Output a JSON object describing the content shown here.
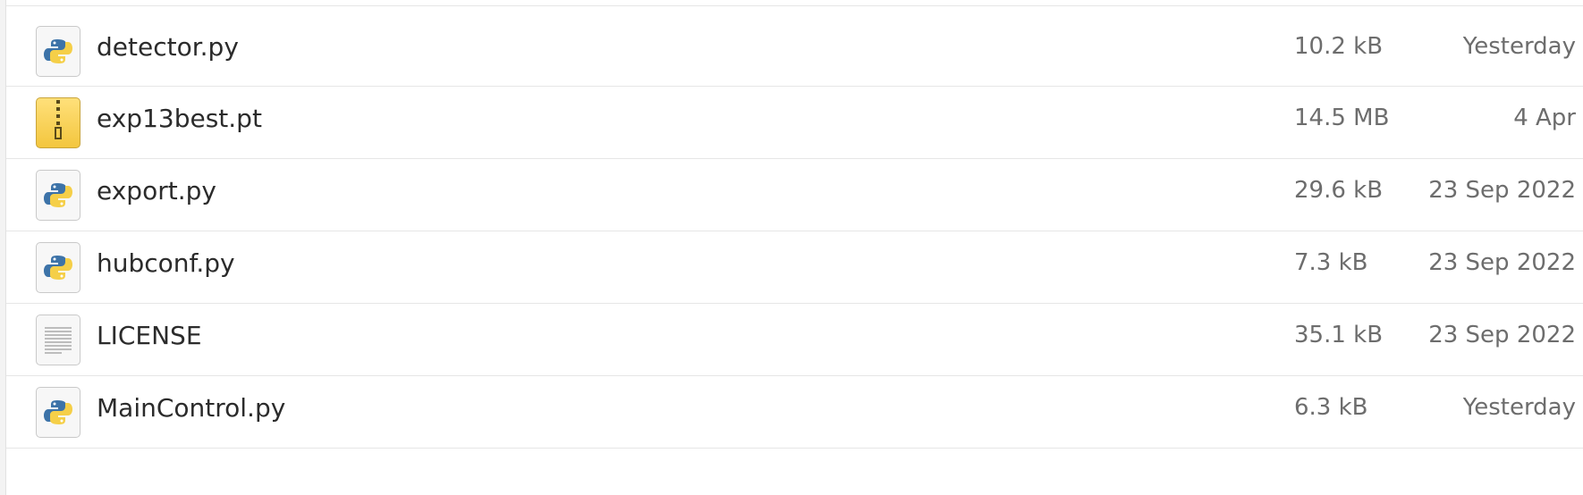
{
  "files": [
    {
      "name": "detector.py",
      "size": "10.2 kB",
      "modified": "Yesterday",
      "icon": "python-file-icon"
    },
    {
      "name": "exp13best.pt",
      "size": "14.5 MB",
      "modified": "4 Apr",
      "icon": "archive-file-icon"
    },
    {
      "name": "export.py",
      "size": "29.6 kB",
      "modified": "23 Sep 2022",
      "icon": "python-file-icon"
    },
    {
      "name": "hubconf.py",
      "size": "7.3 kB",
      "modified": "23 Sep 2022",
      "icon": "python-file-icon"
    },
    {
      "name": "LICENSE",
      "size": "35.1 kB",
      "modified": "23 Sep 2022",
      "icon": "text-file-icon"
    },
    {
      "name": "MainControl.py",
      "size": "6.3 kB",
      "modified": "Yesterday",
      "icon": "python-file-icon"
    }
  ],
  "colors": {
    "text": "#2b2b2b",
    "secondary_text": "#6d6d6d",
    "separator": "#e6e6e6",
    "python_blue": "#3d73a8",
    "python_yellow": "#f5cf48",
    "archive_yellow": "#f3c63e"
  }
}
